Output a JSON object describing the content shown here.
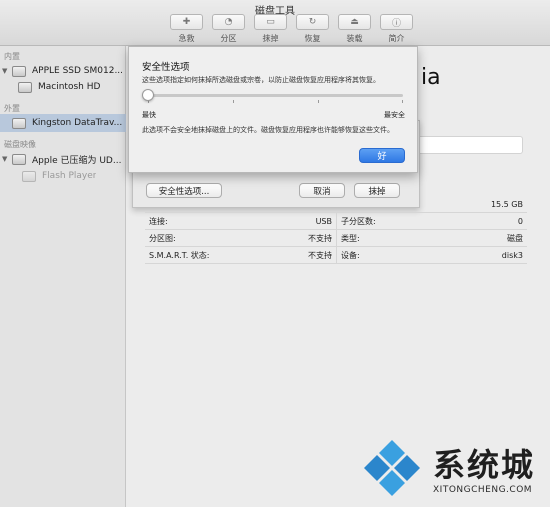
{
  "window": {
    "title": "磁盘工具"
  },
  "toolbar": [
    {
      "label": "急救",
      "icon": "first-aid-icon",
      "glyph": "✚"
    },
    {
      "label": "分区",
      "icon": "partition-icon",
      "glyph": "◔"
    },
    {
      "label": "抹掉",
      "icon": "erase-icon",
      "glyph": "▭"
    },
    {
      "label": "恢复",
      "icon": "restore-icon",
      "glyph": "↻"
    },
    {
      "label": "装载",
      "icon": "mount-icon",
      "glyph": "⏏"
    },
    {
      "label": "简介",
      "icon": "info-icon",
      "glyph": "ⓘ"
    }
  ],
  "sidebar": {
    "sections": [
      {
        "label": "内置"
      },
      {
        "label": "外置"
      },
      {
        "label": "磁盘映像"
      }
    ],
    "items": [
      {
        "label": "APPLE SSD SM012...",
        "icon": "internal-disk-icon"
      },
      {
        "label": "Macintosh HD",
        "icon": "volume-icon"
      },
      {
        "label": "Kingston DataTrav...",
        "icon": "external-disk-icon"
      },
      {
        "label": "Apple 已压缩为 UD...",
        "icon": "disk-image-icon"
      },
      {
        "label": "Flash Player",
        "icon": "mounted-image-icon"
      }
    ]
  },
  "main": {
    "title_fragment": "ia"
  },
  "erase_sheet": {
    "security_options_button": "安全性选项...",
    "cancel_button": "取消",
    "erase_button": "抹掉"
  },
  "security_dialog": {
    "title": "安全性选项",
    "description": "这些选项指定如何抹掉所选磁盘或宗卷，以防止磁盘恢复应用程序将其恢复。",
    "slider_min_label": "最快",
    "slider_max_label": "最安全",
    "slider_level": 0,
    "info": "此选项不会安全地抹掉磁盘上的文件。磁盘恢复应用程序也许能够恢复这些文件。",
    "ok_button": "好"
  },
  "info_grid": {
    "capacity": "15.5 GB",
    "rows": [
      {
        "l_label": "连接:",
        "l_value": "USB",
        "r_label": "子分区数:",
        "r_value": "0"
      },
      {
        "l_label": "分区图:",
        "l_value": "不支持",
        "r_label": "类型:",
        "r_value": "磁盘"
      },
      {
        "l_label": "S.M.A.R.T. 状态:",
        "l_value": "不支持",
        "r_label": "设备:",
        "r_value": "disk3"
      }
    ]
  },
  "watermark": {
    "brand": "系统城",
    "url": "XITONGCHENG.COM"
  },
  "colors": {
    "accent": "#2f78e4",
    "selection": "#b8c8dc",
    "watermark_blue": "#3aa0e0"
  }
}
